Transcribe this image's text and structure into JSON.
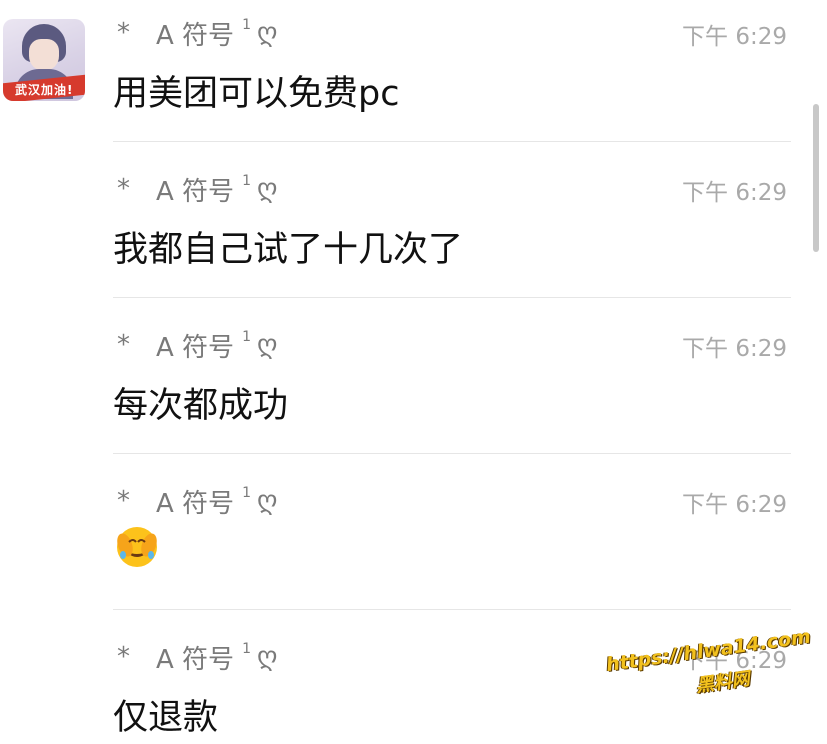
{
  "avatar": {
    "badge_text": "武汉加油!"
  },
  "messages": [
    {
      "sender": {
        "star": "*",
        "name": "A 符号",
        "sup": "1",
        "glyph": "ღ"
      },
      "time": "下午 6:29",
      "text": "用美团可以免费pc"
    },
    {
      "sender": {
        "star": "*",
        "name": "A 符号",
        "sup": "1",
        "glyph": "ღ"
      },
      "time": "下午 6:29",
      "text": "我都自己试了十几次了"
    },
    {
      "sender": {
        "star": "*",
        "name": "A 符号",
        "sup": "1",
        "glyph": "ღ"
      },
      "time": "下午 6:29",
      "text": "每次都成功"
    },
    {
      "sender": {
        "star": "*",
        "name": "A 符号",
        "sup": "1",
        "glyph": "ღ"
      },
      "time": "下午 6:29",
      "emoji": "face-palm-laughing-emoji"
    },
    {
      "sender": {
        "star": "*",
        "name": "A 符号",
        "sup": "1",
        "glyph": "ღ"
      },
      "time": "下午 6:29",
      "text": "仅退款"
    }
  ],
  "watermark": {
    "url": "https://hlwa14.com",
    "site": "黑料网"
  },
  "colors": {
    "name": "#7a7a7a",
    "time": "#a9a9a9",
    "text": "#111111",
    "divider": "#e6e6e6",
    "watermark": "#f2c11e"
  }
}
